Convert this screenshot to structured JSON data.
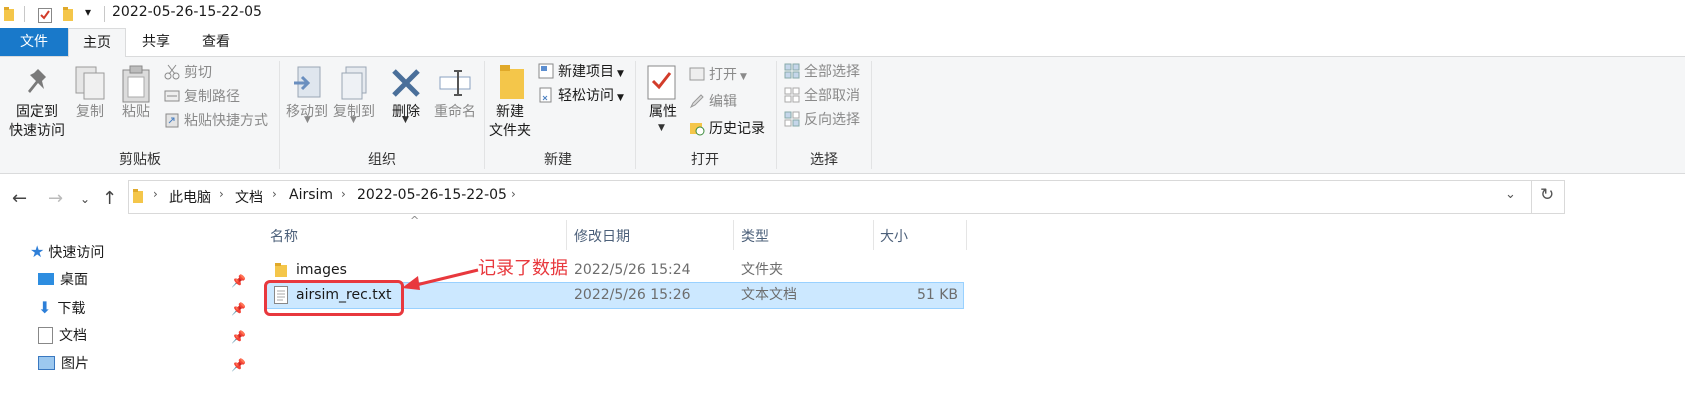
{
  "window": {
    "title": "2022-05-26-15-22-05"
  },
  "quick_access_toolbar": {
    "customize_glyph": "▾"
  },
  "ribbon_tabs": [
    "文件",
    "主页",
    "共享",
    "查看"
  ],
  "ribbon": {
    "clipboard": {
      "pin_label_line1": "固定到",
      "pin_label_line2": "快速访问",
      "copy_label": "复制",
      "paste_label": "粘贴",
      "cut_label": "剪切",
      "copy_path_label": "复制路径",
      "paste_shortcut_label": "粘贴快捷方式",
      "group_label": "剪贴板"
    },
    "organize": {
      "move_to_label": "移动到",
      "copy_to_label": "复制到",
      "delete_label": "删除",
      "rename_label": "重命名",
      "group_label": "组织"
    },
    "new": {
      "new_folder_line1": "新建",
      "new_folder_line2": "文件夹",
      "new_item_label": "新建项目",
      "easy_access_label": "轻松访问",
      "group_label": "新建"
    },
    "open": {
      "properties_label": "属性",
      "open_label": "打开",
      "edit_label": "编辑",
      "history_label": "历史记录",
      "group_label": "打开"
    },
    "select": {
      "select_all_label": "全部选择",
      "select_none_label": "全部取消",
      "invert_label": "反向选择",
      "group_label": "选择"
    }
  },
  "address_bar": {
    "crumbs": [
      "此电脑",
      "文档",
      "Airsim",
      "2022-05-26-15-22-05"
    ]
  },
  "nav_pane": {
    "items": [
      {
        "label": "快速访问",
        "icon": "star-icon"
      },
      {
        "label": "桌面",
        "icon": "desktop-icon"
      },
      {
        "label": "下载",
        "icon": "download-icon"
      },
      {
        "label": "文档",
        "icon": "document-icon"
      },
      {
        "label": "图片",
        "icon": "picture-icon"
      }
    ]
  },
  "file_list": {
    "columns": [
      "名称",
      "修改日期",
      "类型",
      "大小"
    ],
    "rows": [
      {
        "name": "images",
        "modified": "2022/5/26 15:24",
        "type": "文件夹",
        "size": ""
      },
      {
        "name": "airsim_rec.txt",
        "modified": "2022/5/26 15:26",
        "type": "文本文档",
        "size": "51 KB"
      }
    ]
  },
  "annotation": {
    "text": "记录了数据",
    "color": "#e8383d"
  },
  "colors": {
    "file_tab": "#1979ca",
    "selection": "#cce8ff",
    "folder": "#f4c64a"
  }
}
